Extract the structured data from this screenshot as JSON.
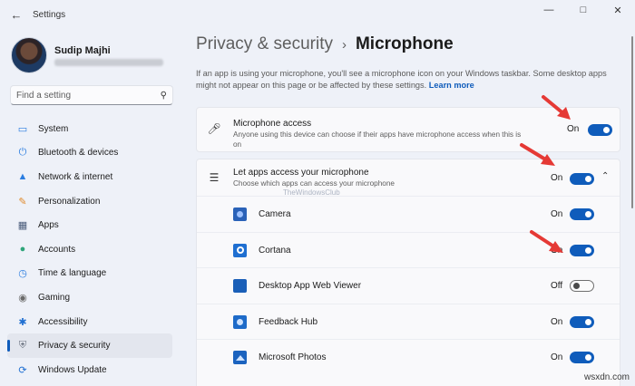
{
  "titlebar": {
    "back_icon": "arrow-left-icon",
    "title": "Settings",
    "minimize_icon": "minimize-icon",
    "maximize_icon": "maximize-icon",
    "close_icon": "close-icon"
  },
  "profile": {
    "name": "Sudip Majhi",
    "email": ""
  },
  "search": {
    "placeholder": "Find a setting",
    "icon": "search-icon"
  },
  "sidebar": {
    "items": [
      {
        "label": "System",
        "icon": "monitor-icon",
        "active": false
      },
      {
        "label": "Bluetooth & devices",
        "icon": "bluetooth-icon",
        "active": false
      },
      {
        "label": "Network & internet",
        "icon": "wifi-icon",
        "active": false
      },
      {
        "label": "Personalization",
        "icon": "brush-icon",
        "active": false
      },
      {
        "label": "Apps",
        "icon": "apps-icon",
        "active": false
      },
      {
        "label": "Accounts",
        "icon": "person-icon",
        "active": false
      },
      {
        "label": "Time & language",
        "icon": "globe-clock-icon",
        "active": false
      },
      {
        "label": "Gaming",
        "icon": "gamepad-icon",
        "active": false
      },
      {
        "label": "Accessibility",
        "icon": "accessibility-icon",
        "active": false
      },
      {
        "label": "Privacy & security",
        "icon": "shield-icon",
        "active": true
      },
      {
        "label": "Windows Update",
        "icon": "update-icon",
        "active": false
      }
    ]
  },
  "breadcrumb": {
    "parent": "Privacy & security",
    "separator": "›",
    "current": "Microphone"
  },
  "intro": {
    "text": "If an app is using your microphone, you'll see a microphone icon on your Windows taskbar. Some desktop apps might not appear on this page or be affected by these settings. ",
    "link": "Learn more"
  },
  "microphone_access": {
    "icon": "microphone-icon",
    "title": "Microphone access",
    "description": "Anyone using this device can choose if their apps have microphone access when this is on",
    "state": "On",
    "on": true
  },
  "apps_access": {
    "icon": "list-icon",
    "title": "Let apps access your microphone",
    "description": "Choose which apps can access your microphone",
    "state": "On",
    "on": true,
    "chevron": "chevron-up-icon"
  },
  "apps": [
    {
      "label": "Camera",
      "icon": "camera-icon",
      "state": "On",
      "on": true,
      "color": "#2a62b8"
    },
    {
      "label": "Cortana",
      "icon": "cortana-icon",
      "state": "On",
      "on": true,
      "color": "#1f6fd1"
    },
    {
      "label": "Desktop App Web Viewer",
      "icon": "web-viewer-icon",
      "state": "Off",
      "on": false,
      "color": "#1a5fb8"
    },
    {
      "label": "Feedback Hub",
      "icon": "feedback-hub-icon",
      "state": "On",
      "on": true,
      "color": "#1e6bc9"
    },
    {
      "label": "Microsoft Photos",
      "icon": "photos-icon",
      "state": "On",
      "on": true,
      "color": "#1b63bf"
    }
  ],
  "watermark": "TheWindowsClub",
  "site_mark": "wsxdn.com",
  "colors": {
    "accent": "#0f5cbb",
    "annotation_arrow": "#e53935",
    "background": "#eef1f8",
    "card": "#f9f9fb"
  }
}
